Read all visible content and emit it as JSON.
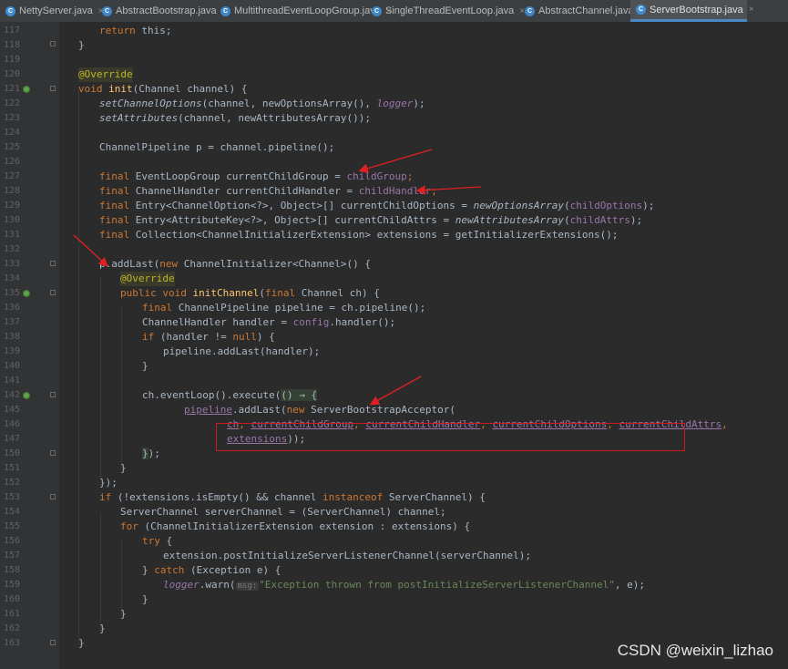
{
  "tabs": [
    {
      "label": "NettyServer.java",
      "active": false
    },
    {
      "label": "AbstractBootstrap.java",
      "active": false
    },
    {
      "label": "MultithreadEventLoopGroup.java",
      "active": false
    },
    {
      "label": "SingleThreadEventLoop.java",
      "active": false
    },
    {
      "label": "AbstractChannel.java",
      "active": false
    },
    {
      "label": "ServerBootstrap.java",
      "active": true
    }
  ],
  "tab_close_glyph": "×",
  "line_numbers": [
    "117",
    "118",
    "119",
    "120",
    "121",
    "122",
    "123",
    "124",
    "125",
    "126",
    "127",
    "128",
    "129",
    "130",
    "131",
    "132",
    "133",
    "134",
    "135",
    "136",
    "137",
    "138",
    "139",
    "140",
    "141",
    "142",
    "145",
    "146",
    "147",
    "150",
    "151",
    "152",
    "153",
    "154",
    "155",
    "156",
    "157",
    "158",
    "159",
    "160",
    "161",
    "162",
    "163"
  ],
  "watermark": "CSDN @weixin_lizhao",
  "colors": {
    "editor_bg": "#2b2b2b",
    "keyword": "#cc7832",
    "annotation": "#bbb529",
    "method": "#ffc66d",
    "field": "#9876aa",
    "string": "#6a8759",
    "text": "#a9b7c6",
    "highlight_box": "#d0191c",
    "arrow": "#e02020"
  },
  "code": {
    "l117": {
      "kw": "return",
      "rest": " this;"
    },
    "l118": "}",
    "l120": "@Override",
    "l121": {
      "kw": "void",
      "fn": "init",
      "rest": "(Channel channel) {"
    },
    "l122": {
      "call": "setChannelOptions",
      "a": "(channel, newOptionsArray(), ",
      "logger": "logger",
      "b": ");"
    },
    "l123": {
      "call": "setAttributes",
      "a": "(channel, newAttributesArray());"
    },
    "l125": "ChannelPipeline p = channel.pipeline();",
    "l127": {
      "kw": "final",
      "a": " EventLoopGroup currentChildGroup = ",
      "f": "childGroup",
      "b": ";"
    },
    "l128": {
      "kw": "final",
      "a": " ChannelHandler currentChildHandler = ",
      "f": "childHandler",
      "b": ";"
    },
    "l129": {
      "kw": "final",
      "a": " Entry<ChannelOption<?>, Object>[] currentChildOptions = ",
      "call": "newOptionsArray",
      "p1": "(",
      "f": "childOptions",
      "b": ");"
    },
    "l130": {
      "kw": "final",
      "a": " Entry<AttributeKey<?>, Object>[] currentChildAttrs = ",
      "call": "newAttributesArray",
      "p1": "(",
      "f": "childAttrs",
      "b": ");"
    },
    "l131": {
      "kw": "final",
      "a": " Collection<ChannelInitializerExtension> extensions = getInitializerExtensions();"
    },
    "l133": {
      "a": "p.addLast(",
      "kw": "new",
      "b": " ChannelInitializer<Channel>() {"
    },
    "l134": "@Override",
    "l135": {
      "kw1": "public",
      "kw2": "void",
      "fn": "initChannel",
      "p": "(",
      "kw3": "final",
      "b": " Channel ch) {"
    },
    "l136": {
      "kw": "final",
      "a": " ChannelPipeline pipeline = ch.pipeline();"
    },
    "l137": {
      "a": "ChannelHandler handler = ",
      "f": "config",
      "b": ".handler();"
    },
    "l138": {
      "kw": "if",
      "a": " (handler != ",
      "kw2": "null",
      "b": ") {"
    },
    "l139": "pipeline.addLast(handler);",
    "l140": "}",
    "l142": {
      "a": "ch.eventLoop().execute(",
      "lam": "() → {"
    },
    "l145": {
      "u": "pipeline",
      "a": ".addLast(",
      "kw": "new",
      "b": " ServerBootstrapAcceptor("
    },
    "l146": {
      "v1": "ch",
      ",": ", ",
      "v2": "currentChildGroup",
      "v3": "currentChildHandler",
      "v4": "currentChildOptions",
      "v5": "currentChildAttrs",
      "end": ","
    },
    "l147": {
      "v": "extensions",
      "end": "));"
    },
    "l150": {
      "a": "}",
      "b": ");"
    },
    "l151": "}",
    "l152": "});",
    "l153": {
      "kw": "if",
      "a": " (!extensions.isEmpty() && channel ",
      "kw2": "instanceof",
      "b": " ServerChannel) {"
    },
    "l154": "ServerChannel serverChannel = (ServerChannel) channel;",
    "l155": {
      "kw": "for",
      "a": " (ChannelInitializerExtension extension : extensions) {"
    },
    "l156": {
      "kw": "try",
      "a": " {"
    },
    "l157": "extension.postInitializeServerListenerChannel(serverChannel);",
    "l158": {
      "a": "} ",
      "kw": "catch",
      "b": " (Exception e) {"
    },
    "l159": {
      "f": "logger",
      "a": ".warn(",
      "hint": "msg:",
      "s": "\"Exception thrown from postInitializeServerListenerChannel\"",
      "b": ", e);"
    },
    "l160": "}",
    "l161": "}",
    "l162": "}",
    "l163": "}"
  }
}
